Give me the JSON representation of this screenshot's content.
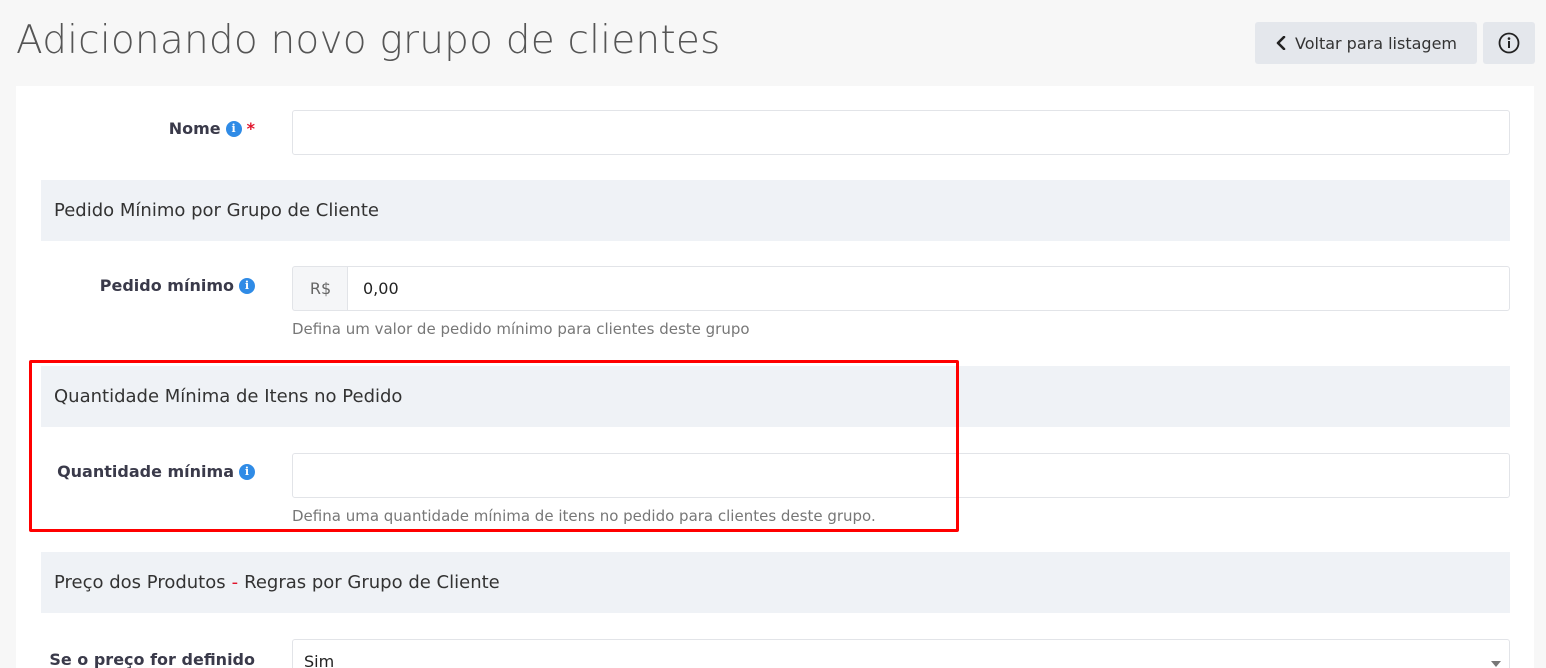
{
  "header": {
    "title": "Adicionando novo grupo de clientes",
    "back_button_label": "Voltar para listagem"
  },
  "form": {
    "name_label": "Nome",
    "required_mark": "*",
    "section_min_order": "Pedido Mínimo por Grupo de Cliente",
    "min_order_label": "Pedido mínimo",
    "currency_prefix": "R$",
    "min_order_value": "0,00",
    "min_order_help": "Defina um valor de pedido mínimo para clientes deste grupo",
    "section_min_qty": "Quantidade Mínima de Itens no Pedido",
    "min_qty_label": "Quantidade mínima",
    "min_qty_value": "",
    "min_qty_help": "Defina uma quantidade mínima de itens no pedido para clientes deste grupo.",
    "section_prices_part1": "Preço dos Produtos",
    "section_prices_dash": "-",
    "section_prices_part2": "Regras por Grupo de Cliente",
    "price_defined_label": "Se o preço for definido",
    "price_defined_value": "Sim"
  },
  "icons": {
    "info_small": "info-icon",
    "back": "chevron-left-icon",
    "help": "info-circle-icon"
  },
  "colors": {
    "info_blue": "#2f8be6",
    "required_red": "#e0142b",
    "highlight": "#ff0000",
    "section_bg": "#eff2f6"
  }
}
